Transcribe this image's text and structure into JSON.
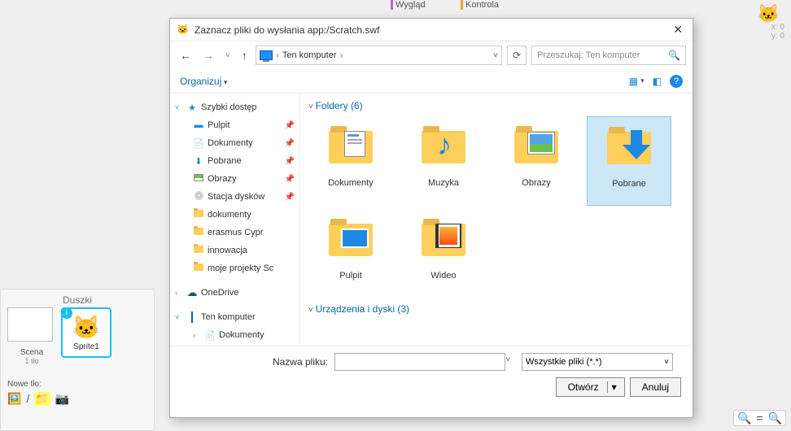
{
  "bg": {
    "cat1": "Wygląd",
    "cat2": "Kontrola",
    "coord_x": "x: 0",
    "coord_y": "y: 0"
  },
  "spritepanel": {
    "header": "Duszki",
    "scene": "Scena",
    "scene_sub": "1 tło",
    "sprite_name": "Sprite1",
    "new_label": "Nowe tło:"
  },
  "dialog": {
    "title": "Zaznacz pliki do wysłania app:/Scratch.swf",
    "crumb": "Ten komputer",
    "search_placeholder": "Przeszukaj: Ten komputer",
    "organize": "Organizuj",
    "tree": {
      "quick": "Szybki dostęp",
      "desktop": "Pulpit",
      "documents": "Dokumenty",
      "downloads": "Pobrane",
      "pictures": "Obrazy",
      "drives": "Stacja dysków",
      "f_dokumenty": "dokumenty",
      "f_erasmus": "erasmus Cypr",
      "f_innowacja": "innowacja",
      "f_moje": "moje projekty Sc",
      "onedrive": "OneDrive",
      "thispc": "Ten komputer",
      "pc_docs": "Dokumenty"
    },
    "sections": {
      "folders": "Foldery (6)",
      "devices": "Urządzenia i dyski (3)"
    },
    "files": {
      "documents": "Dokumenty",
      "music": "Muzyka",
      "pictures": "Obrazy",
      "downloads": "Pobrane",
      "desktop": "Pulpit",
      "videos": "Wideo"
    },
    "form": {
      "name_label": "Nazwa pliku:",
      "filter": "Wszystkie pliki (*.*)",
      "open": "Otwórz",
      "cancel": "Anuluj"
    }
  }
}
